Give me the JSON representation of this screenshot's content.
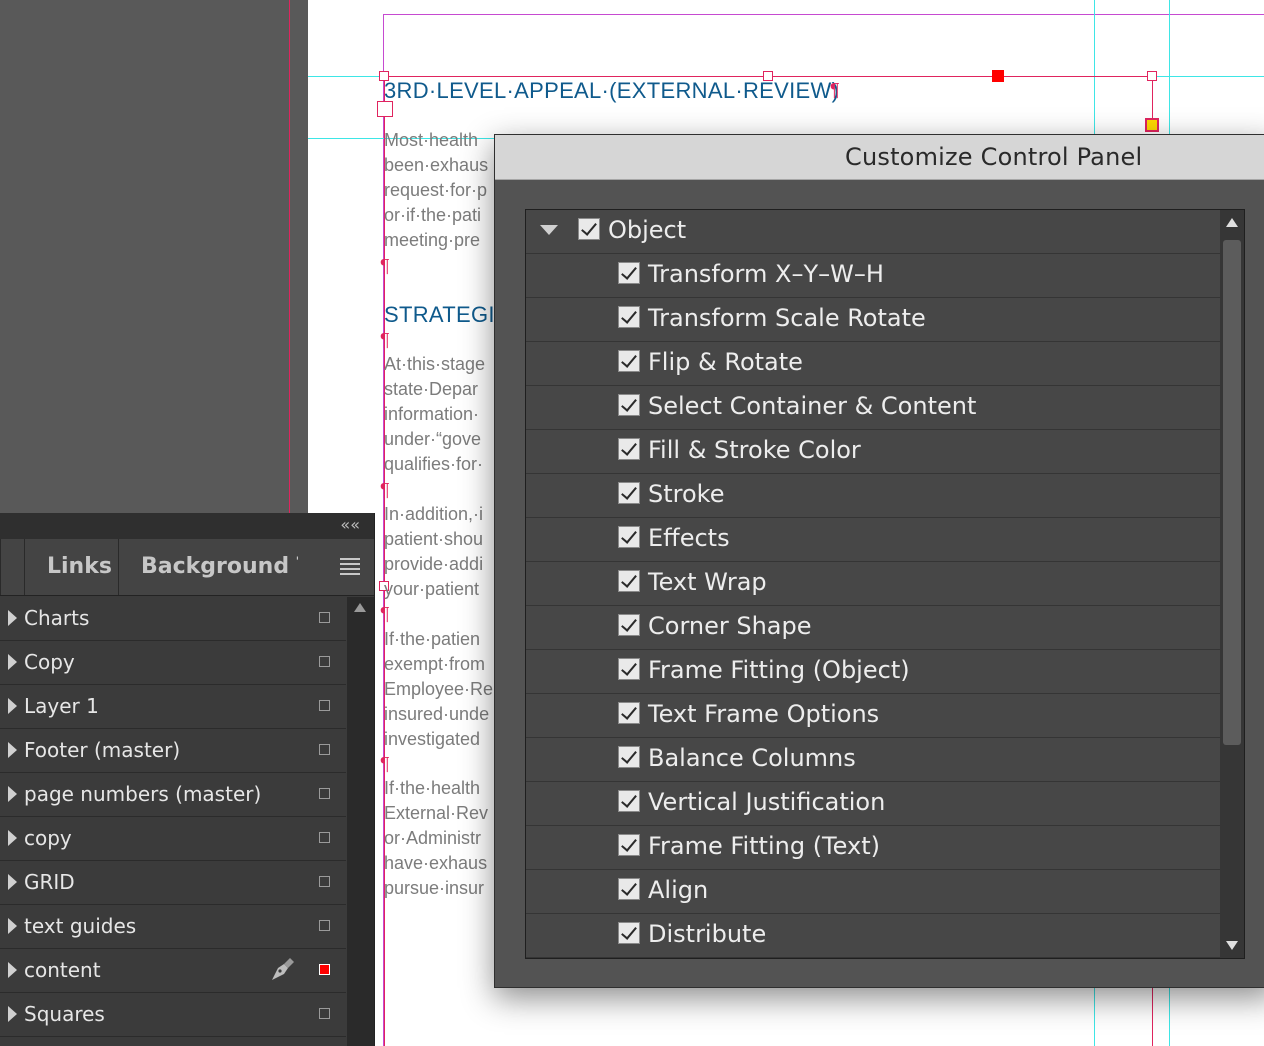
{
  "document": {
    "heading1": "3RD·LEVEL·APPEAL·(EXTERNAL·REVIEW)",
    "heading2": "STRATEGI",
    "body_lines": [
      "Most·health",
      "been·exhaus",
      "request·for·p",
      "or·if·the·pati",
      "meeting·pre",
      "At·this·stage",
      "state·Depar",
      "information·",
      "under·“gove",
      "qualifies·for·",
      "In·addition,·i",
      "patient·shou",
      "provide·addi",
      "your·patient",
      "If·the·patien",
      "exempt·from",
      "Employee·Re",
      "insured·unde",
      "investigated",
      "If·the·health",
      "External·Rev",
      "or·Administr",
      "have·exhaus",
      "pursue·insur"
    ],
    "pilcrow": "¶"
  },
  "layers_panel": {
    "collapse_icon": "««",
    "tabs": [
      "Links",
      "Background T"
    ],
    "menu_icon": "panel-menu-icon",
    "layers": [
      {
        "name": "Charts",
        "color": "#9a9a9a",
        "locked_pen": false
      },
      {
        "name": "Copy",
        "color": "#9a9a9a",
        "locked_pen": false
      },
      {
        "name": "Layer 1",
        "color": "#9a9a9a",
        "locked_pen": false
      },
      {
        "name": "Footer (master)",
        "color": "#9a9a9a",
        "locked_pen": false
      },
      {
        "name": "page numbers (master)",
        "color": "#9a9a9a",
        "locked_pen": false
      },
      {
        "name": "copy",
        "color": "#9a9a9a",
        "locked_pen": false
      },
      {
        "name": "GRID",
        "color": "#9a9a9a",
        "locked_pen": false
      },
      {
        "name": "text guides",
        "color": "#9a9a9a",
        "locked_pen": false
      },
      {
        "name": "content",
        "color": "#ff0000",
        "locked_pen": true
      },
      {
        "name": "Squares",
        "color": "#9a9a9a",
        "locked_pen": false
      }
    ]
  },
  "dialog": {
    "title": "Customize Control Panel",
    "group": {
      "label": "Object",
      "checked": true,
      "expanded": true
    },
    "options": [
      {
        "label": "Transform X–Y–W–H",
        "checked": true
      },
      {
        "label": "Transform Scale Rotate",
        "checked": true
      },
      {
        "label": "Flip & Rotate",
        "checked": true
      },
      {
        "label": "Select Container & Content",
        "checked": true
      },
      {
        "label": "Fill & Stroke Color",
        "checked": true
      },
      {
        "label": "Stroke",
        "checked": true
      },
      {
        "label": "Effects",
        "checked": true
      },
      {
        "label": "Text Wrap",
        "checked": true
      },
      {
        "label": "Corner Shape",
        "checked": true
      },
      {
        "label": "Frame Fitting (Object)",
        "checked": true
      },
      {
        "label": "Text Frame Options",
        "checked": true
      },
      {
        "label": "Balance Columns",
        "checked": true
      },
      {
        "label": "Vertical Justification",
        "checked": true
      },
      {
        "label": "Frame Fitting (Text)",
        "checked": true
      },
      {
        "label": "Align",
        "checked": true
      },
      {
        "label": "Distribute",
        "checked": true
      }
    ]
  }
}
